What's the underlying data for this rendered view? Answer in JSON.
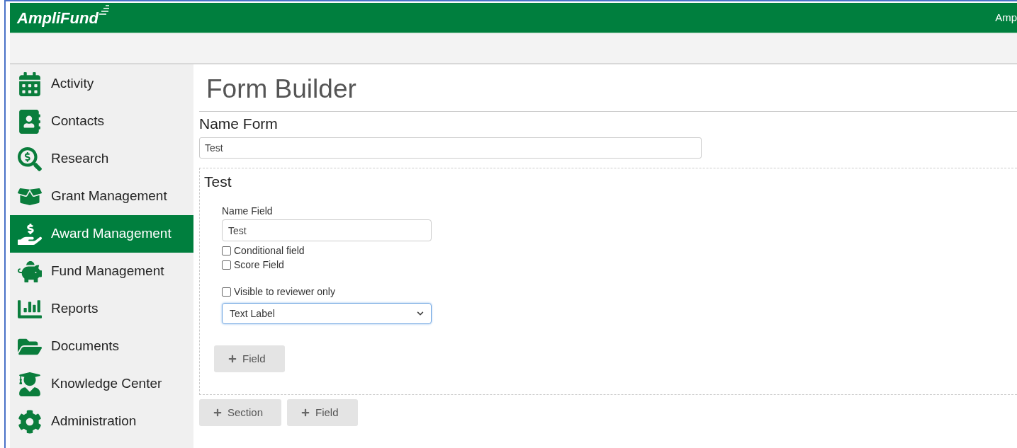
{
  "header": {
    "logo": "AmpliFund",
    "user": "Amp"
  },
  "sidebar": {
    "items": [
      {
        "label": "Activity",
        "selected": false
      },
      {
        "label": "Contacts",
        "selected": false
      },
      {
        "label": "Research",
        "selected": false
      },
      {
        "label": "Grant Management",
        "selected": false
      },
      {
        "label": "Award Management",
        "selected": true
      },
      {
        "label": "Fund Management",
        "selected": false
      },
      {
        "label": "Reports",
        "selected": false
      },
      {
        "label": "Documents",
        "selected": false
      },
      {
        "label": "Knowledge Center",
        "selected": false
      },
      {
        "label": "Administration",
        "selected": false
      }
    ]
  },
  "page": {
    "title": "Form Builder",
    "form_name_label": "Name Form",
    "form_name_value": "Test",
    "section": {
      "title": "Test",
      "field": {
        "name_label": "Name Field",
        "name_value": "Test",
        "checkboxes": [
          {
            "label": "Conditional field",
            "checked": false
          },
          {
            "label": "Score Field",
            "checked": false
          }
        ],
        "reviewer_checkbox": {
          "label": "Visible to reviewer only",
          "checked": false
        },
        "type_select": "Text Label"
      },
      "add_field_button": "Field"
    },
    "buttons": [
      "Section",
      "Field"
    ]
  }
}
